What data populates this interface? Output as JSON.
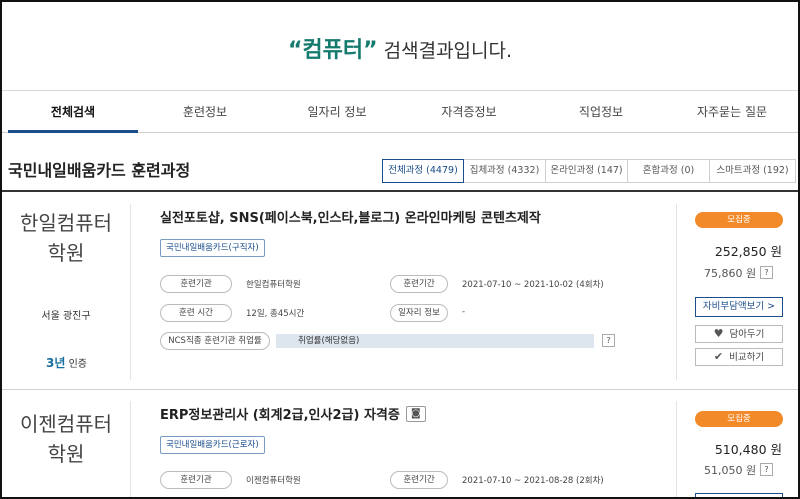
{
  "search": {
    "quoted_keyword": "“컴퓨터”",
    "result_suffix": " 검색결과입니다."
  },
  "tabs": [
    {
      "label": "전체검색",
      "active": true
    },
    {
      "label": "훈련정보"
    },
    {
      "label": "일자리 정보"
    },
    {
      "label": "자격증정보"
    },
    {
      "label": "직업정보"
    },
    {
      "label": "자주묻는 질문"
    }
  ],
  "section": {
    "title": "국민내일배움카드 훈련과정",
    "filters": [
      {
        "label": "전체과정 (4479)",
        "active": true
      },
      {
        "label": "집체과정 (4332)"
      },
      {
        "label": "온라인과정 (147)"
      },
      {
        "label": "혼합과정 (0)"
      },
      {
        "label": "스마트과정 (192)"
      }
    ]
  },
  "courses": [
    {
      "institution_line1": "한일컴퓨터",
      "institution_line2": "학원",
      "location": "서울 광진구",
      "certification_prefix": "3년",
      "certification_suffix": "인증",
      "title": "실전포토샵, SNS(페이스북,인스타,블로그) 온라인마케팅 콘텐츠제작",
      "card_type_tag": "국민내일배움카드(구직자)",
      "labels": {
        "institution": "훈련기관",
        "period": "훈련기간",
        "hours": "훈련 시간",
        "job_info": "일자리 정보",
        "ncs_rate": "NCS직종 훈련기관 취업률"
      },
      "institution_value": "한일컴퓨터학원",
      "period_value": "2021-07-10 ~ 2021-10-02 (4회차)",
      "hours_value": "12일, 총45시간",
      "job_info_value": "-",
      "employment_rate": "취업률(해당없음)",
      "help": "?",
      "recruit_badge": "모집중",
      "price": "252,850 원",
      "self_pay": "75,860 원",
      "self_pay_btn": "자비부담액보기 >",
      "save_btn": "담아두기",
      "compare_btn": "비교하기"
    },
    {
      "institution_line1": "이젠컴퓨터",
      "institution_line2": "학원",
      "title": "ERP정보관리사 (회계2급,인사2급) 자격증",
      "card_type_tag": "국민내일배움카드(근로자)",
      "labels": {
        "institution": "훈련기관",
        "period": "훈련기간"
      },
      "institution_value": "이젠컴퓨터학원",
      "period_value": "2021-07-10 ~ 2021-08-28 (2회차)",
      "help": "?",
      "recruit_badge": "모집중",
      "price": "510,480 원",
      "self_pay": "51,050 원"
    }
  ],
  "colors": {
    "accent_blue": "#1a4d8a",
    "keyword_green": "#157a6e",
    "recruit_orange": "#f28a2a"
  }
}
